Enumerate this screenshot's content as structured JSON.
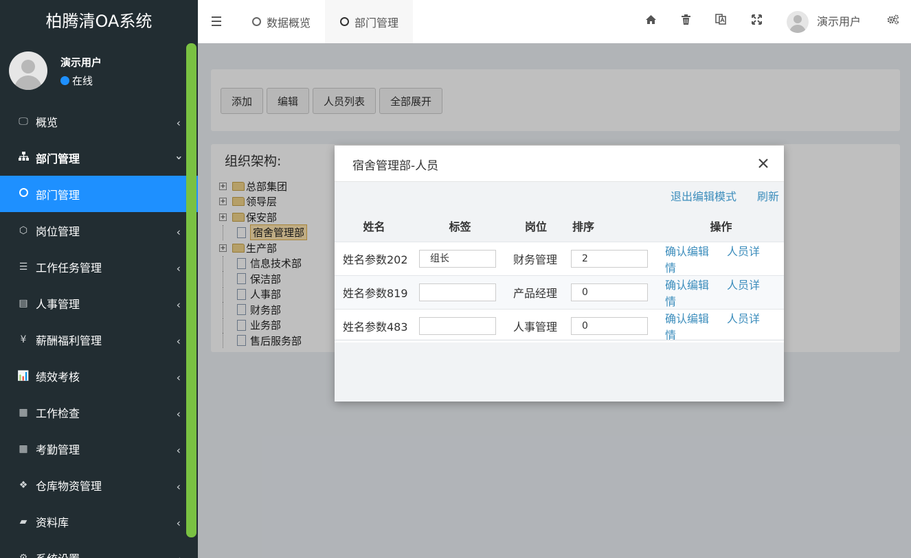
{
  "app": {
    "title": "柏腾清OA系统"
  },
  "user": {
    "name": "演示用户",
    "status": "在线"
  },
  "menu": [
    {
      "label": "概览",
      "icon": "monitor-icon"
    },
    {
      "label": "部门管理",
      "icon": "sitemap-icon"
    },
    {
      "label": "部门管理",
      "icon": "circle-icon"
    },
    {
      "label": "岗位管理",
      "icon": "cube-icon"
    },
    {
      "label": "工作任务管理",
      "icon": "list-icon"
    },
    {
      "label": "人事管理",
      "icon": "id-card-icon"
    },
    {
      "label": "薪酬福利管理",
      "icon": "yen-icon"
    },
    {
      "label": "绩效考核",
      "icon": "bar-chart-icon"
    },
    {
      "label": "工作检查",
      "icon": "calculator-icon"
    },
    {
      "label": "考勤管理",
      "icon": "calendar-icon"
    },
    {
      "label": "仓库物资管理",
      "icon": "cubes-icon"
    },
    {
      "label": "资料库",
      "icon": "book-icon"
    },
    {
      "label": "系统设置",
      "icon": "gear-icon"
    }
  ],
  "tabs": [
    {
      "label": "数据概览"
    },
    {
      "label": "部门管理"
    }
  ],
  "topbar": {
    "user": "演示用户"
  },
  "toolbar": {
    "add": "添加",
    "edit": "编辑",
    "staff_list": "人员列表",
    "expand_all": "全部展开"
  },
  "org": {
    "title": "组织架构:",
    "nodes": [
      {
        "label": "总部集团",
        "type": "folder",
        "expandable": true
      },
      {
        "label": "领导层",
        "type": "folder",
        "expandable": true
      },
      {
        "label": "保安部",
        "type": "folder",
        "expandable": true
      },
      {
        "label": "宿舍管理部",
        "type": "file",
        "expandable": false
      },
      {
        "label": "生产部",
        "type": "folder",
        "expandable": true
      },
      {
        "label": "信息技术部",
        "type": "file",
        "expandable": false
      },
      {
        "label": "保洁部",
        "type": "file",
        "expandable": false
      },
      {
        "label": "人事部",
        "type": "file",
        "expandable": false
      },
      {
        "label": "财务部",
        "type": "file",
        "expandable": false
      },
      {
        "label": "业务部",
        "type": "file",
        "expandable": false
      },
      {
        "label": "售后服务部",
        "type": "file",
        "expandable": false
      }
    ]
  },
  "modal": {
    "title": "宿舍管理部-人员",
    "close": "×",
    "exit_edit": "退出编辑模式",
    "refresh": "刷新",
    "columns": {
      "name": "姓名",
      "tag": "标签",
      "position": "岗位",
      "order": "排序",
      "ops": "操作"
    },
    "rows": [
      {
        "name": "姓名参数202",
        "tag": "组长",
        "position": "财务管理",
        "order": "2",
        "confirm": "确认编辑",
        "detail": "人员详情"
      },
      {
        "name": "姓名参数819",
        "tag": "",
        "position": "产品经理",
        "order": "0",
        "confirm": "确认编辑",
        "detail": "人员详情"
      },
      {
        "name": "姓名参数483",
        "tag": "",
        "position": "人事管理",
        "order": "0",
        "confirm": "确认编辑",
        "detail": "人员详情"
      }
    ]
  }
}
